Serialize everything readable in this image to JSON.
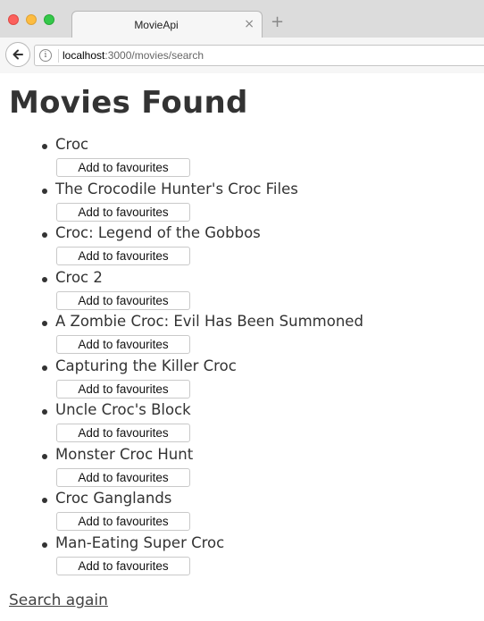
{
  "browser": {
    "tab_title": "MovieApi",
    "tab_close": "×",
    "new_tab": "+",
    "url_host": "localhost",
    "url_path": ":3000/movies/search",
    "info_glyph": "i"
  },
  "page": {
    "heading": "Movies Found",
    "search_again": "Search again"
  },
  "movies": [
    {
      "title": "Croc",
      "button": "Add to favourites"
    },
    {
      "title": "The Crocodile Hunter's Croc Files",
      "button": "Add to favourites"
    },
    {
      "title": "Croc: Legend of the Gobbos",
      "button": "Add to favourites"
    },
    {
      "title": "Croc 2",
      "button": "Add to favourites"
    },
    {
      "title": "A Zombie Croc: Evil Has Been Summoned",
      "button": "Add to favourites"
    },
    {
      "title": "Capturing the Killer Croc",
      "button": "Add to favourites"
    },
    {
      "title": "Uncle Croc's Block",
      "button": "Add to favourites"
    },
    {
      "title": "Monster Croc Hunt",
      "button": "Add to favourites"
    },
    {
      "title": "Croc Ganglands",
      "button": "Add to favourites"
    },
    {
      "title": "Man-Eating Super Croc",
      "button": "Add to favourites"
    }
  ],
  "colors": {
    "text": "#333333",
    "link": "#444444"
  }
}
